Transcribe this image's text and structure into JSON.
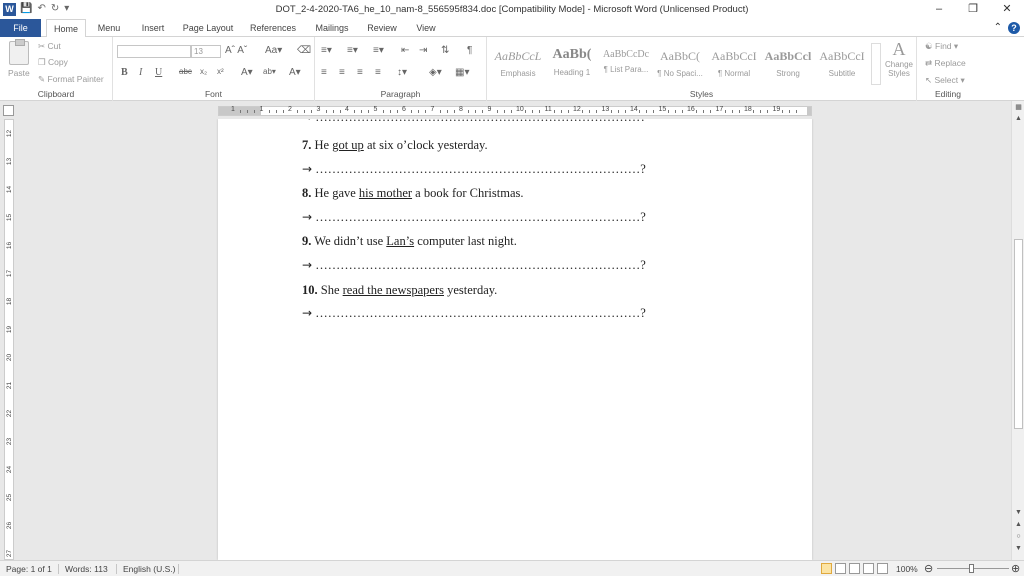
{
  "window": {
    "title": "DOT_2-4-2020-TA6_he_10_nam-8_556595f834.doc [Compatibility Mode]  -  Microsoft Word (Unlicensed Product)",
    "app_icon": "W"
  },
  "tabs": [
    "File",
    "Home",
    "Menu",
    "Insert",
    "Page Layout",
    "References",
    "Mailings",
    "Review",
    "View"
  ],
  "clipboard": {
    "paste": "Paste",
    "cut": "Cut",
    "copy": "Copy",
    "format_painter": "Format Painter",
    "label": "Clipboard"
  },
  "font": {
    "name": "",
    "size": "13",
    "label": "Font"
  },
  "paragraph": {
    "label": "Paragraph"
  },
  "styles": {
    "label": "Styles",
    "items": [
      {
        "sample": "AaBbCcL",
        "name": "Emphasis"
      },
      {
        "sample": "AaBb(",
        "name": "Heading 1"
      },
      {
        "sample": "AaBbCcDc",
        "name": "¶ List Para..."
      },
      {
        "sample": "AaBbC(",
        "name": "¶ No Spaci..."
      },
      {
        "sample": "AaBbCcI",
        "name": "¶ Normal"
      },
      {
        "sample": "AaBbCcl",
        "name": "Strong"
      },
      {
        "sample": "AaBbCcI",
        "name": "Subtitle"
      }
    ],
    "change_styles": "Change Styles"
  },
  "editing": {
    "find": "Find",
    "replace": "Replace",
    "select": "Select",
    "label": "Editing"
  },
  "ruler": {
    "numbers": [
      "1",
      "1",
      "2",
      "3",
      "4",
      "5",
      "6",
      "7",
      "8",
      "9",
      "10",
      "11",
      "12",
      "13",
      "14",
      "15",
      "16",
      "17",
      "18",
      "19"
    ]
  },
  "vruler": {
    "numbers": [
      "12",
      "13",
      "14",
      "15",
      "16",
      "17",
      "18",
      "19",
      "20",
      "21",
      "22",
      "23",
      "24",
      "25",
      "26",
      "27"
    ]
  },
  "document": {
    "top_dots": "……………………………………………………………………?",
    "questions": [
      {
        "num": "7.",
        "pre": "He ",
        "underline": "got up",
        "post": " at six o’clock yesterday."
      },
      {
        "num": "8.",
        "pre": "He gave ",
        "underline": "his mother",
        "post": " a book for Christmas."
      },
      {
        "num": "9.",
        "pre": "We didn’t use ",
        "underline": "Lan’s",
        "post": " computer last night."
      },
      {
        "num": "10.",
        "pre": "She ",
        "underline": "read the newspapers",
        "post": " yesterday."
      }
    ],
    "arrow": "→",
    "answer_dots": "……………………………………………………………………?"
  },
  "status": {
    "page": "Page: 1 of 1",
    "words": "Words: 113",
    "language": "English (U.S.)",
    "zoom": "100%"
  }
}
